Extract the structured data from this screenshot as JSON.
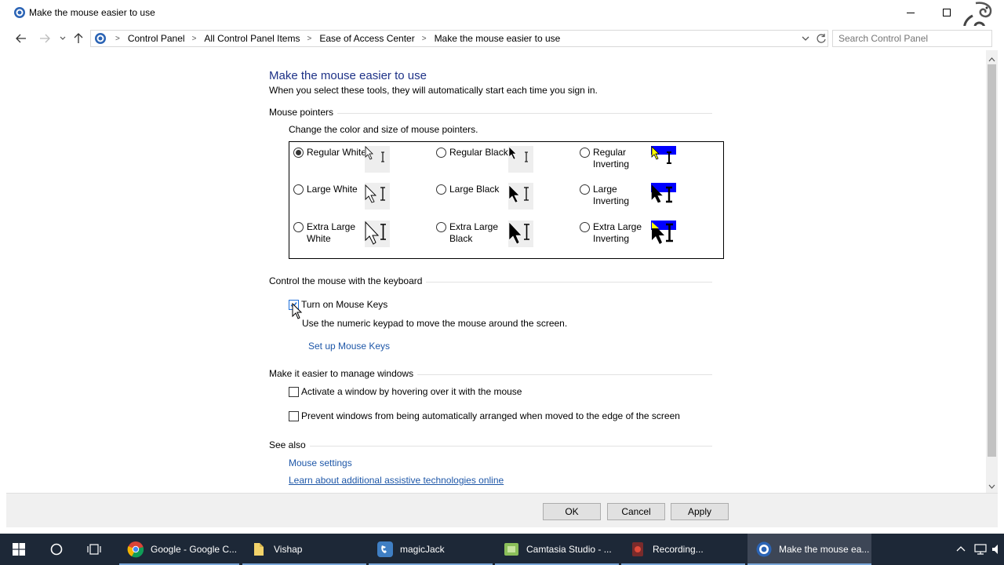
{
  "window": {
    "title": "Make the mouse easier to use"
  },
  "address_bar": {
    "crumbs": [
      "Control Panel",
      "All Control Panel Items",
      "Ease of Access Center",
      "Make the mouse easier to use"
    ],
    "search_placeholder": "Search Control Panel"
  },
  "page": {
    "title": "Make the mouse easier to use",
    "subtitle": "When you select these tools, they will automatically start each time you sign in.",
    "mouse_pointers": {
      "heading": "Mouse pointers",
      "description": "Change the color and size of mouse pointers.",
      "options": [
        {
          "label": "Regular White",
          "selected": true
        },
        {
          "label": "Regular Black",
          "selected": false
        },
        {
          "label": "Regular Inverting",
          "selected": false
        },
        {
          "label": "Large White",
          "selected": false
        },
        {
          "label": "Large Black",
          "selected": false
        },
        {
          "label": "Large Inverting",
          "selected": false
        },
        {
          "label": "Extra Large White",
          "selected": false
        },
        {
          "label": "Extra Large Black",
          "selected": false
        },
        {
          "label": "Extra Large Inverting",
          "selected": false
        }
      ]
    },
    "keyboard": {
      "heading": "Control the mouse with the keyboard",
      "mouse_keys_label": "Turn on Mouse Keys",
      "mouse_keys_checked": true,
      "mouse_keys_description": "Use the numeric keypad to move the mouse around the screen.",
      "setup_link": "Set up Mouse Keys"
    },
    "windows": {
      "heading": "Make it easier to manage windows",
      "hover_label": "Activate a window by hovering over it with the mouse",
      "hover_checked": false,
      "snap_label": "Prevent windows from being automatically arranged when moved to the edge of the screen",
      "snap_checked": false
    },
    "see_also": {
      "heading": "See also",
      "links": [
        "Mouse settings",
        "Learn about additional assistive technologies online"
      ]
    }
  },
  "buttons": {
    "ok": "OK",
    "cancel": "Cancel",
    "apply": "Apply"
  },
  "taskbar": {
    "apps": [
      {
        "label": "Google - Google C...",
        "icon": "chrome-icon"
      },
      {
        "label": "Vishap",
        "icon": "folder-icon"
      },
      {
        "label": "magicJack",
        "icon": "magicjack-icon"
      },
      {
        "label": "Camtasia Studio - ...",
        "icon": "camtasia-icon"
      },
      {
        "label": "Recording...",
        "icon": "recorder-icon"
      },
      {
        "label": "Make the mouse ea...",
        "icon": "control-panel-icon"
      }
    ]
  },
  "colors": {
    "title_blue": "#1e3287",
    "link_blue": "#1e57a8",
    "taskbar": "#1d2837",
    "inverting_blue": "#0000ff",
    "inverting_yellow": "#ffff00"
  }
}
